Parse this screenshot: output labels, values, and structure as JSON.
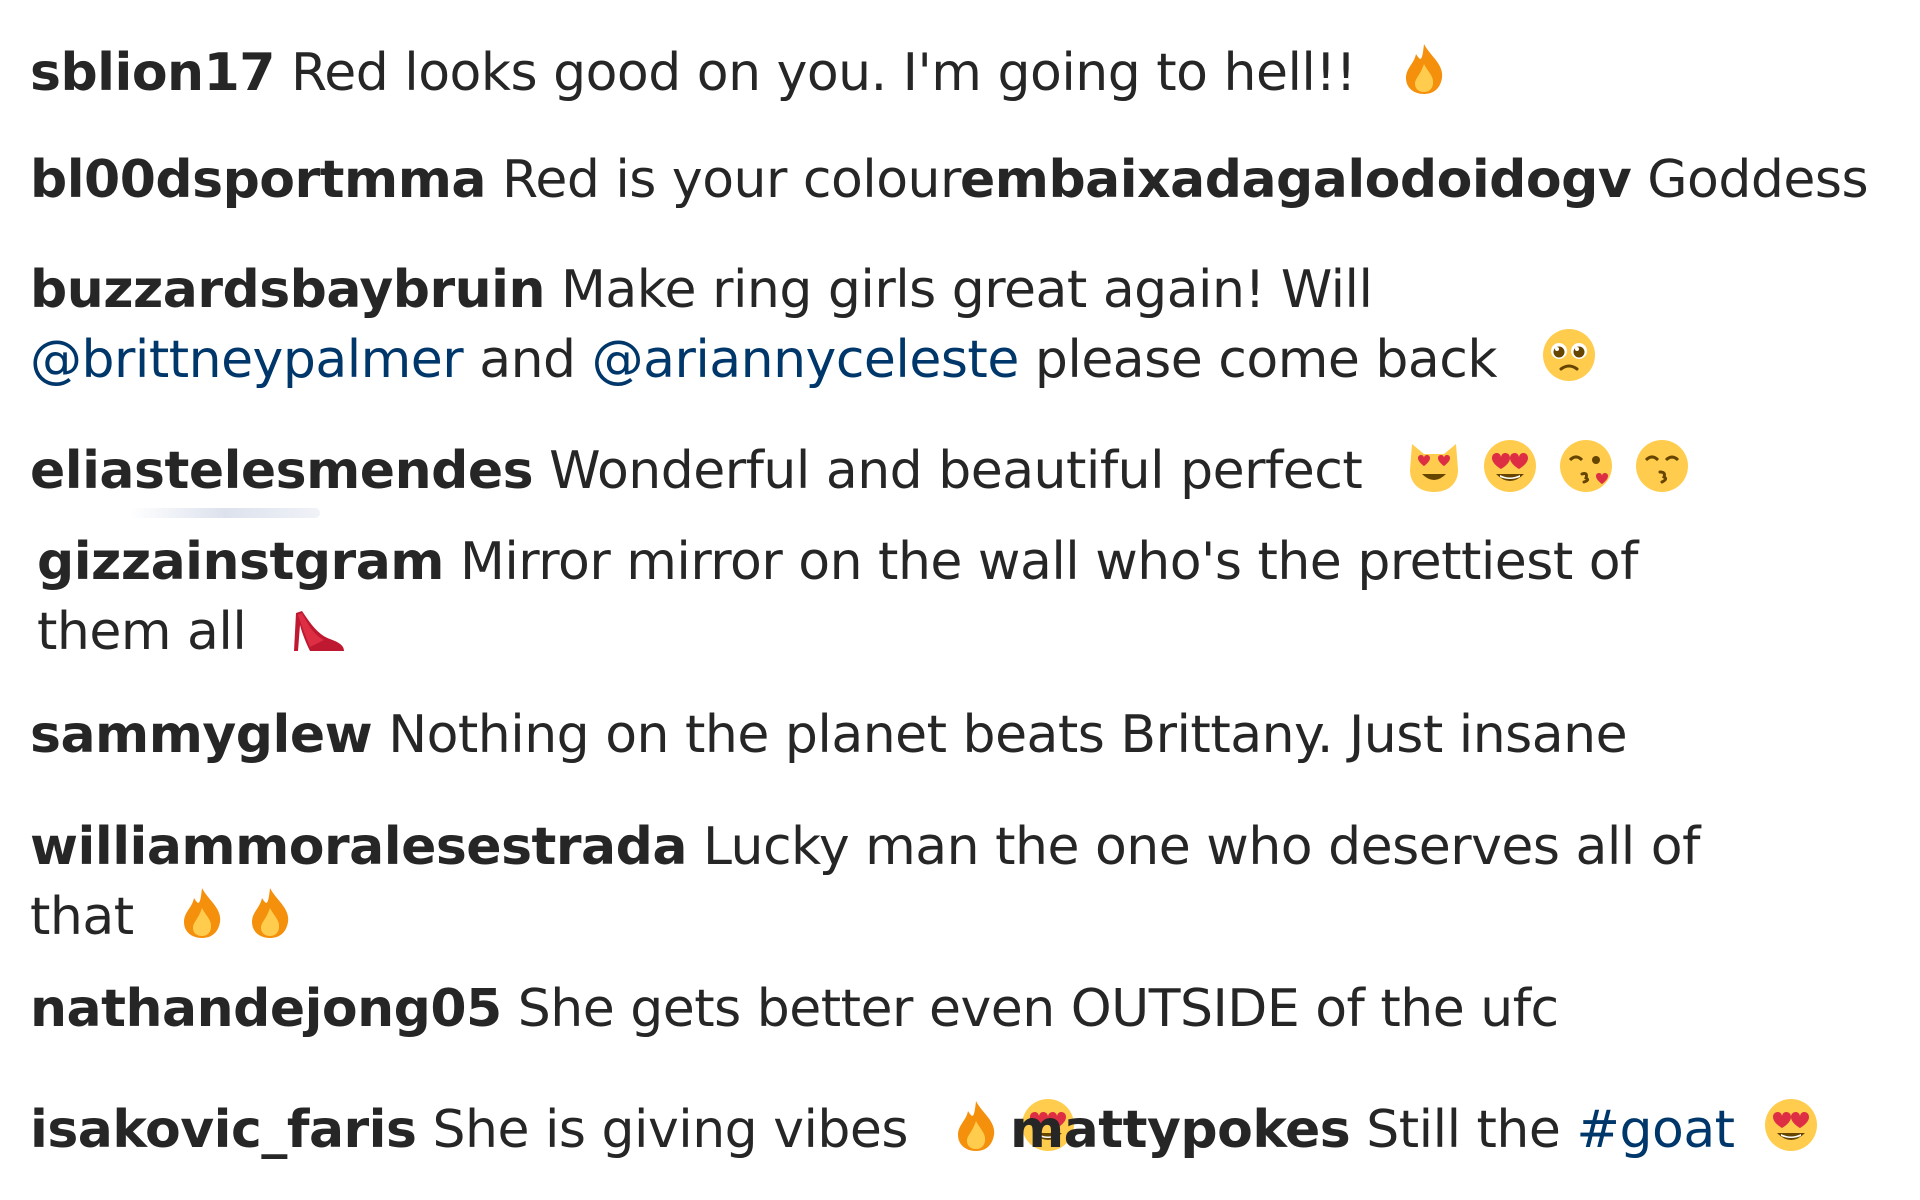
{
  "comments": [
    {
      "username": "sblion17",
      "text": " Red looks good on you. I'm going to hell!! ",
      "emojis": [
        "fire-icon"
      ]
    },
    {
      "username": "bl00dsportmma",
      "text": " Red is your colour"
    },
    {
      "username": "embaixadagalodoidogv",
      "text": " Goddess"
    },
    {
      "username": "buzzardsbaybruin",
      "text": " Make ring girls great again! Will",
      "mention_1": "@brittneypalmer",
      "joiner": " and ",
      "mention_2": "@ariannyceleste",
      "text_end": " please come back ",
      "emojis": [
        "pleading-face-icon"
      ]
    },
    {
      "username": "eliastelesmendes",
      "text": " Wonderful and beautiful perfect ",
      "emojis": [
        "heart-eyes-cat-icon",
        "heart-eyes-face-icon",
        "kissing-heart-face-icon",
        "kissing-smiling-eyes-icon"
      ]
    },
    {
      "username": "gizzainstgram",
      "text": " Mirror mirror on the wall who's the prettiest of",
      "text_line2": "them all ",
      "emojis": [
        "high-heel-shoe-icon"
      ]
    },
    {
      "username": "sammyglew",
      "text": " Nothing on the planet beats Brittany. Just insane"
    },
    {
      "username": "williammoralesestrada",
      "text": " Lucky man the one who deserves all of",
      "text_line2": "that ",
      "emojis": [
        "fire-icon",
        "fire-icon"
      ]
    },
    {
      "username": "nathandejong05",
      "text": " She gets better even OUTSIDE of the ufc"
    },
    {
      "username": "isakovic_faris",
      "text": " She is giving vibes ",
      "emojis": [
        "fire-icon",
        "heart-eyes-face-icon"
      ]
    },
    {
      "username": "mattypokes",
      "text": " Still the ",
      "hashtag": "#goat",
      "emojis": [
        "heart-eyes-face-icon"
      ]
    }
  ],
  "colors": {
    "text": "#262626",
    "link": "#00376b",
    "background": "#ffffff"
  }
}
